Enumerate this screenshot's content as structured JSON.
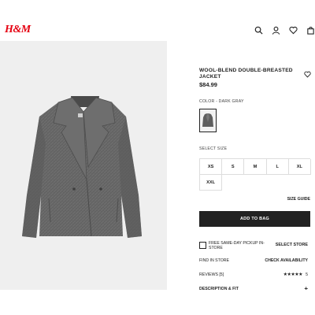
{
  "header": {
    "logo": "H&M",
    "icons": [
      "search-icon",
      "account-icon",
      "favorites-icon",
      "cart-icon"
    ]
  },
  "product": {
    "title": "WOOL-BLEND DOUBLE-BREASTED JACKET",
    "price": "$84.99",
    "color_label": "COLOR - DARK GRAY",
    "select_size_label": "SELECT SIZE",
    "sizes": [
      "XS",
      "S",
      "M",
      "L",
      "XL",
      "XXL"
    ],
    "size_guide": "SIZE GUIDE",
    "add_to_bag": "ADD TO BAG",
    "pickup_text": "FREE SAME-DAY PICKUP IN-STORE",
    "select_store": "SELECT STORE",
    "find_in_store": "FIND IN STORE",
    "check_availability": "CHECK AVAILABILITY",
    "reviews_label": "REVIEWS [5]",
    "stars": "★★★★★",
    "rating": "5",
    "description_label": "DESCRIPTION & FIT",
    "plus": "+"
  },
  "colors": {
    "accent": "#e50010",
    "coat": "#626262",
    "button": "#222222"
  }
}
